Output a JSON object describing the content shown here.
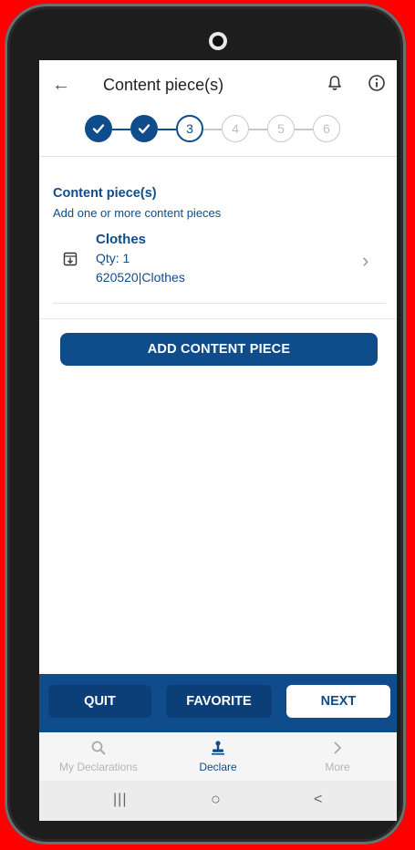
{
  "header": {
    "title": "Content piece(s)",
    "back_icon": "arrow-left-icon",
    "bell_icon": "bell-icon",
    "info_icon": "info-icon"
  },
  "stepper": {
    "steps": [
      "1",
      "2",
      "3",
      "4",
      "5",
      "6"
    ],
    "current_step": 3,
    "completed_steps": 2
  },
  "section": {
    "title": "Content piece(s)",
    "subtitle": "Add one or more content pieces"
  },
  "items": [
    {
      "name": "Clothes",
      "qty": "Qty: 1",
      "code": "620520|Clothes",
      "icon": "download-box-icon"
    }
  ],
  "add_button": {
    "label": "ADD CONTENT PIECE"
  },
  "actions": {
    "quit_label": "QUIT",
    "favorite_label": "FAVORITE",
    "next_label": "NEXT"
  },
  "bottom_nav": {
    "items": [
      {
        "label": "My Declarations",
        "icon": "search-icon"
      },
      {
        "label": "Declare",
        "icon": "stamp-icon"
      },
      {
        "label": "More",
        "icon": "chevron-right-icon"
      }
    ],
    "active_index": 1
  },
  "system_nav": {
    "recent": "|||",
    "home": "○",
    "back": "<"
  },
  "colors": {
    "primary": "#0f4c8c",
    "frame_background": "#ff0000",
    "inactive": "#bdbdbd"
  }
}
